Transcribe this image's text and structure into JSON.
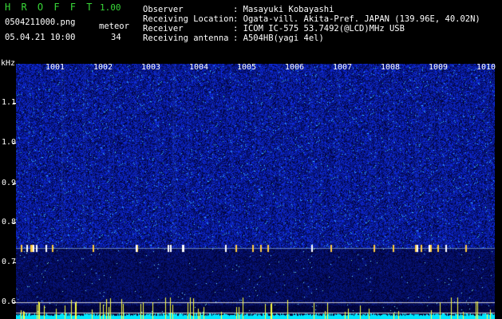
{
  "header": {
    "app_name": "H R O F F T",
    "version": "1.00",
    "filename": "0504211000.png",
    "datetime": "05.04.21 10:00",
    "count_label": "meteor",
    "count_value": "34",
    "info": [
      {
        "label": "Observer",
        "value": ": Masayuki Kobayashi"
      },
      {
        "label": "Receiving Location",
        "value": ": Ogata-vill. Akita-Pref. JAPAN (139.96E, 40.02N)"
      },
      {
        "label": "Receiver",
        "value": ": ICOM IC-575 53.7492(@LCD)MHz USB"
      },
      {
        "label": "Receiving antenna",
        "value": ": A504HB(yagi 4el)"
      }
    ]
  },
  "colors": {
    "title_green": "#38d838",
    "background": "#000000",
    "spectrum_blue": "#0a1aa8",
    "trace_cyan": "#00e8ff",
    "meteor_yellow": "#ffff40"
  },
  "axes": {
    "y_unit": "kHz",
    "y_ticks": [
      "1.1",
      "1.0",
      "0.9",
      "0.8",
      "0.7",
      "0.6"
    ],
    "x_ticks": [
      "1001",
      "1002",
      "1003",
      "1004",
      "1005",
      "1006",
      "1007",
      "1008",
      "1009",
      "1010"
    ]
  },
  "spectrogram": {
    "freq_range_khz": [
      0.58,
      1.19
    ],
    "meteor_band_khz": 0.75,
    "reference_lines_khz": [
      0.62,
      0.595
    ]
  }
}
